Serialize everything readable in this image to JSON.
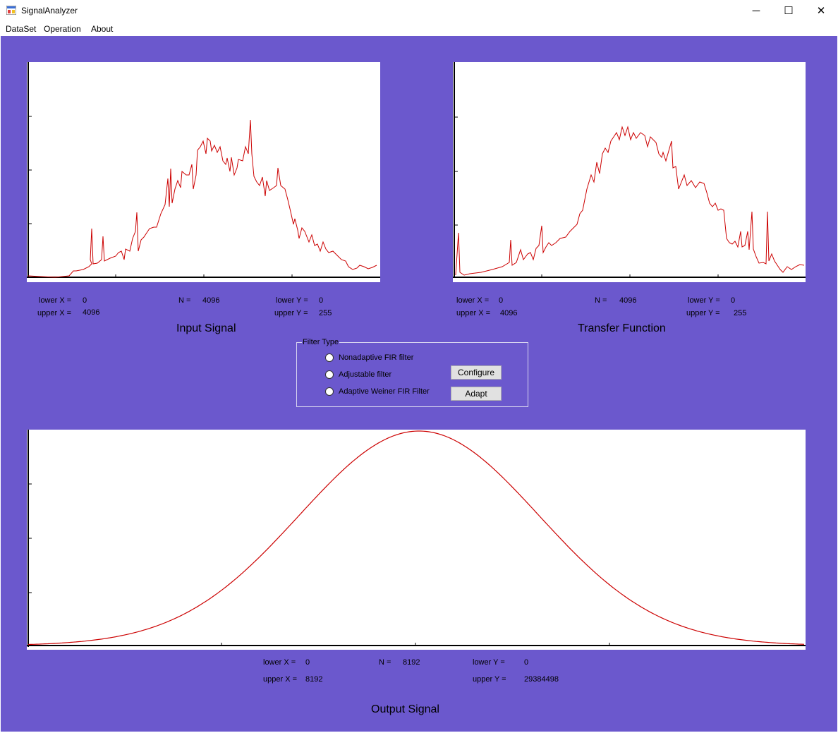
{
  "window": {
    "title": "SignalAnalyzer",
    "minimize_glyph": "─",
    "maximize_glyph": "☐",
    "close_glyph": "✕"
  },
  "menu": [
    "DataSet",
    "Operation",
    "About"
  ],
  "colors": {
    "background": "#6b58cd",
    "plot_line": "#cc0000",
    "plot_bg": "#ffffff"
  },
  "input_signal": {
    "caption": "Input Signal",
    "lower_x_label": "lower X =",
    "lower_x": "0",
    "upper_x_label": "upper X =",
    "upper_x": "4096",
    "n_label": "N =",
    "n": "4096",
    "lower_y_label": "lower Y =",
    "lower_y": "0",
    "upper_y_label": "upper Y =",
    "upper_y": "255"
  },
  "transfer_function": {
    "caption": "Transfer Function",
    "lower_x_label": "lower X =",
    "lower_x": "0",
    "upper_x_label": "upper X =",
    "upper_x": "4096",
    "n_label": "N =",
    "n": "4096",
    "lower_y_label": "lower Y =",
    "lower_y": "0",
    "upper_y_label": "upper Y =",
    "upper_y": "255"
  },
  "filter": {
    "legend": "Filter Type",
    "options": [
      "Nonadaptive FIR filter",
      "Adjustable filter",
      "Adaptive Weiner FIR Filter"
    ],
    "configure_label": "Configure",
    "adapt_label": "Adapt"
  },
  "output_signal": {
    "caption": "Output Signal",
    "lower_x_label": "lower X =",
    "lower_x": "0",
    "upper_x_label": "upper X =",
    "upper_x": "8192",
    "n_label": "N =",
    "n": "8192",
    "lower_y_label": "lower Y =",
    "lower_y": "0",
    "upper_y_label": "upper Y =",
    "upper_y": "29384498"
  }
}
